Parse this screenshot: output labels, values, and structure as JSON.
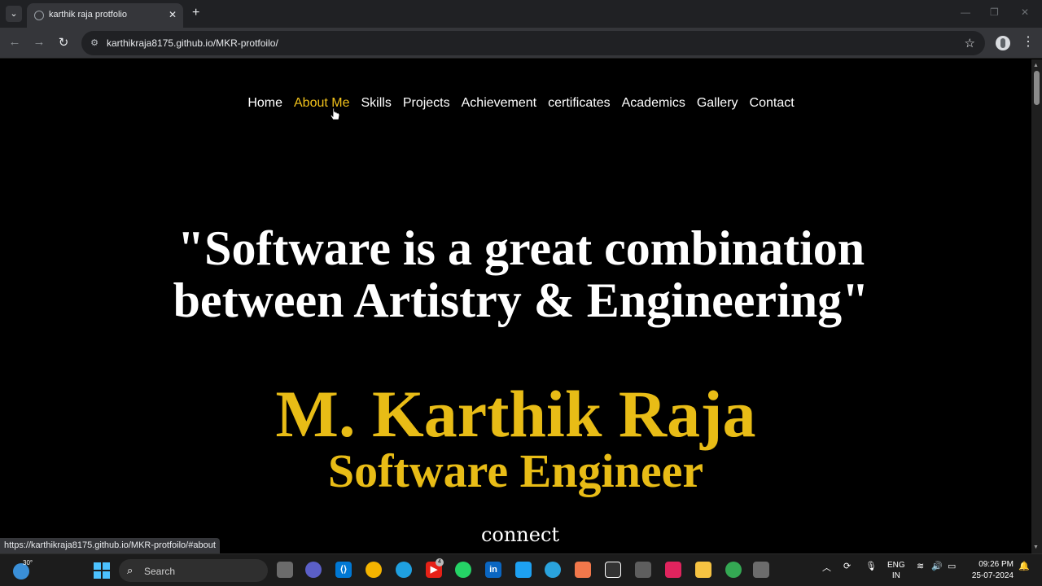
{
  "browser": {
    "tab_title": "karthik raja protfolio",
    "url": "karthikraja8175.github.io/MKR-protfoilo/",
    "status_url": "https://karthikraja8175.github.io/MKR-protfoilo/#about"
  },
  "nav": {
    "items": [
      "Home",
      "About Me",
      "Skills",
      "Projects",
      "Achievement",
      "certificates",
      "Academics",
      "Gallery",
      "Contact"
    ],
    "active_index": 1,
    "active_color": "#f2c21b"
  },
  "hero": {
    "quote_line1": "\"Software is a great combination",
    "quote_line2": "between Artistry & Engineering\"",
    "name": "M. Karthik Raja",
    "role": "Software Engineer",
    "connect": "connect",
    "accent_color": "#e8bc16"
  },
  "taskbar": {
    "temperature": "30°",
    "search_placeholder": "Search",
    "youtube_badge": "4",
    "language_top": "ENG",
    "language_bottom": "IN",
    "time": "09:26 PM",
    "date": "25-07-2024"
  }
}
